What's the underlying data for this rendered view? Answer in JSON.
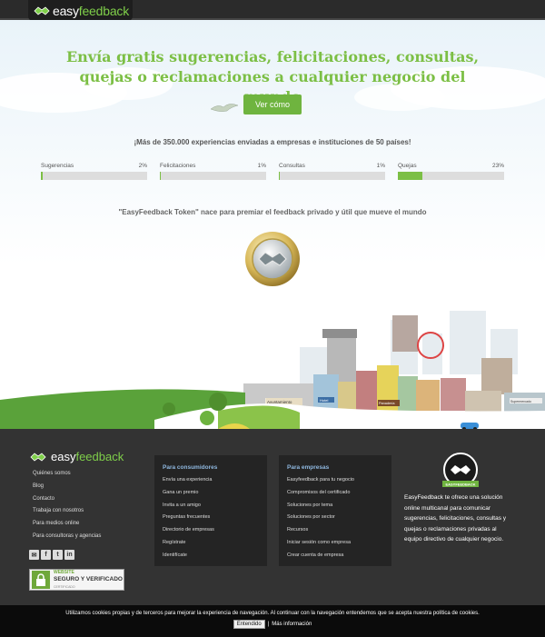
{
  "header": {
    "logo_prefix": "easy",
    "logo_suffix": "feedback"
  },
  "hero": {
    "title": "Envía gratis sugerencias, felicitaciones, consultas, quejas o reclamaciones a cualquier negocio del mundo",
    "cta_label": "Ver cómo",
    "stat_line": "¡Más de 350.000 experiencias enviadas a empresas e instituciones de 50 países!",
    "token_line": "\"EasyFeedback Token\" nace para premiar el feedback privado y útil que mueve el mundo"
  },
  "stats": [
    {
      "label": "Sugerencias",
      "percent_label": "2%",
      "percent": 2
    },
    {
      "label": "Felicitaciones",
      "percent_label": "1%",
      "percent": 1
    },
    {
      "label": "Consultas",
      "percent_label": "1%",
      "percent": 1
    },
    {
      "label": "Quejas",
      "percent_label": "23%",
      "percent": 23
    }
  ],
  "colors": {
    "brand_green": "#7cbf45",
    "footer_bg": "#333333",
    "panel_title": "#8fb8e0"
  },
  "footer": {
    "logo_prefix": "easy",
    "logo_suffix": "feedback",
    "links": [
      "Quiénes somos",
      "Blog",
      "Contacto",
      "Trabaja con nosotros",
      "Para medios online",
      "Para consultoras y agencias"
    ],
    "socials": [
      {
        "icon": "email-icon",
        "glyph": "✉"
      },
      {
        "icon": "facebook-icon",
        "glyph": "f"
      },
      {
        "icon": "twitter-icon",
        "glyph": "t"
      },
      {
        "icon": "linkedin-icon",
        "glyph": "in"
      }
    ],
    "seal": {
      "line1": "WEBSITE",
      "line2": "SEGURO Y VERIFICADO",
      "line3": "CERTIFICADO"
    },
    "consumers": {
      "title": "Para consumidores",
      "items": [
        "Envía una experiencia",
        "Gana un premio",
        "Invita a un amigo",
        "Preguntas frecuentes",
        "Directorio de empresas",
        "Regístrate",
        "Identifícate"
      ]
    },
    "business": {
      "title": "Para empresas",
      "items": [
        "Easyfeedback para tu negocio",
        "Compromisos del certificado",
        "Soluciones por tema",
        "Soluciones por sector",
        "Recursos",
        "Iniciar sesión como empresa",
        "Crear cuenta de empresa"
      ]
    },
    "badge_text": "EASYFEEDBACK",
    "about": "EasyFeedback te ofrece una solución online multicanal para comunicar sugerencias, felicitaciones, consultas y quejas o reclamaciones privadas al equipo directivo de cualquier negocio."
  },
  "city_signs": [
    "Ayuntamiento",
    "Panadería",
    "Hotel",
    "Supermercado"
  ],
  "cookie": {
    "text": "Utilizamos cookies propias y de terceros para mejorar la experiencia de navegación. Al continuar con la navegación entendemos que se acepta nuestra política de cookies.",
    "accept_label": "Entendido",
    "separator": "|",
    "more_label": "Más información"
  }
}
